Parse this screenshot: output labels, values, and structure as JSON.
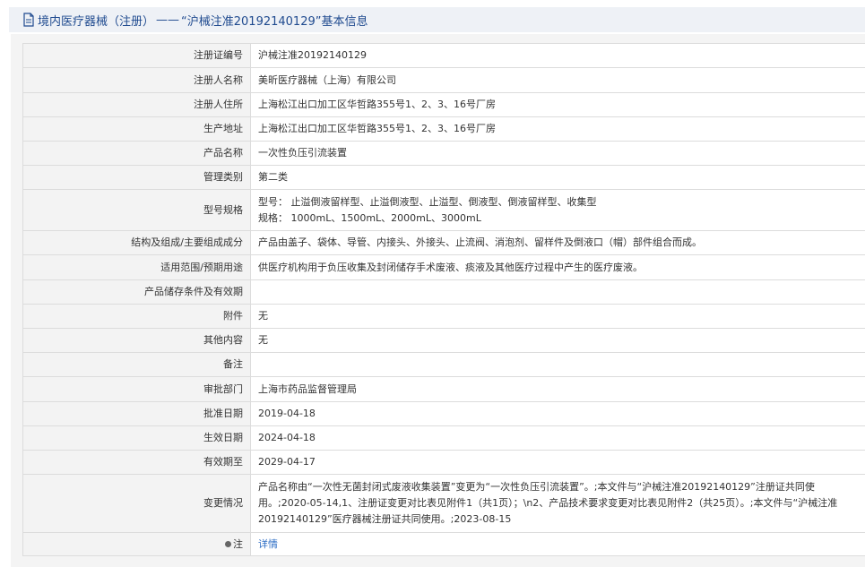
{
  "header": {
    "category": "境内医疗器械（注册）",
    "separator": "——",
    "record_title": "“沪械注准20192140129”基本信息"
  },
  "rows": [
    {
      "label": "注册证编号",
      "value": "沪械注准20192140129"
    },
    {
      "label": "注册人名称",
      "value": "美昕医疗器械（上海）有限公司"
    },
    {
      "label": "注册人住所",
      "value": "上海松江出口加工区华哲路355号1、2、3、16号厂房"
    },
    {
      "label": "生产地址",
      "value": "上海松江出口加工区华哲路355号1、2、3、16号厂房"
    },
    {
      "label": "产品名称",
      "value": "一次性负压引流装置"
    },
    {
      "label": "管理类别",
      "value": "第二类"
    },
    {
      "label": "型号规格",
      "value_lines": [
        "型号： 止溢倒液留样型、止溢倒液型、止溢型、倒液型、倒液留样型、收集型",
        "规格： 1000mL、1500mL、2000mL、3000mL"
      ]
    },
    {
      "label": "结构及组成/主要组成成分",
      "value": "产品由盖子、袋体、导管、内接头、外接头、止流阀、消泡剂、留样件及倒液口（帽）部件组合而成。"
    },
    {
      "label": "适用范围/预期用途",
      "value": "供医疗机构用于负压收集及封闭储存手术废液、痰液及其他医疗过程中产生的医疗废液。"
    },
    {
      "label": "产品储存条件及有效期",
      "value": ""
    },
    {
      "label": "附件",
      "value": "无"
    },
    {
      "label": "其他内容",
      "value": "无"
    },
    {
      "label": "备注",
      "value": ""
    },
    {
      "label": "审批部门",
      "value": "上海市药品监督管理局"
    },
    {
      "label": "批准日期",
      "value": "2019-04-18"
    },
    {
      "label": "生效日期",
      "value": "2024-04-18"
    },
    {
      "label": "有效期至",
      "value": "2029-04-17"
    },
    {
      "label": "变更情况",
      "value": "产品名称由“一次性无菌封闭式废液收集装置”变更为“一次性负压引流装置”。;本文件与“沪械注准20192140129”注册证共同使用。;2020-05-14,1、注册证变更对比表见附件1（共1页）；\\n2、产品技术要求变更对比表见附件2（共25页）。;本文件与“沪械注准20192140129”医疗器械注册证共同使用。;2023-08-15"
    }
  ],
  "memo": {
    "label": "注",
    "link": "详情"
  },
  "colors": {
    "header_bg": "#eef1f6",
    "header_text": "#1f4a8f",
    "label_bg": "#f3f3f3",
    "border": "#dcdcdc",
    "link": "#2b6cc4"
  },
  "icons": {
    "header": "document-icon",
    "memo": "dot-icon"
  }
}
